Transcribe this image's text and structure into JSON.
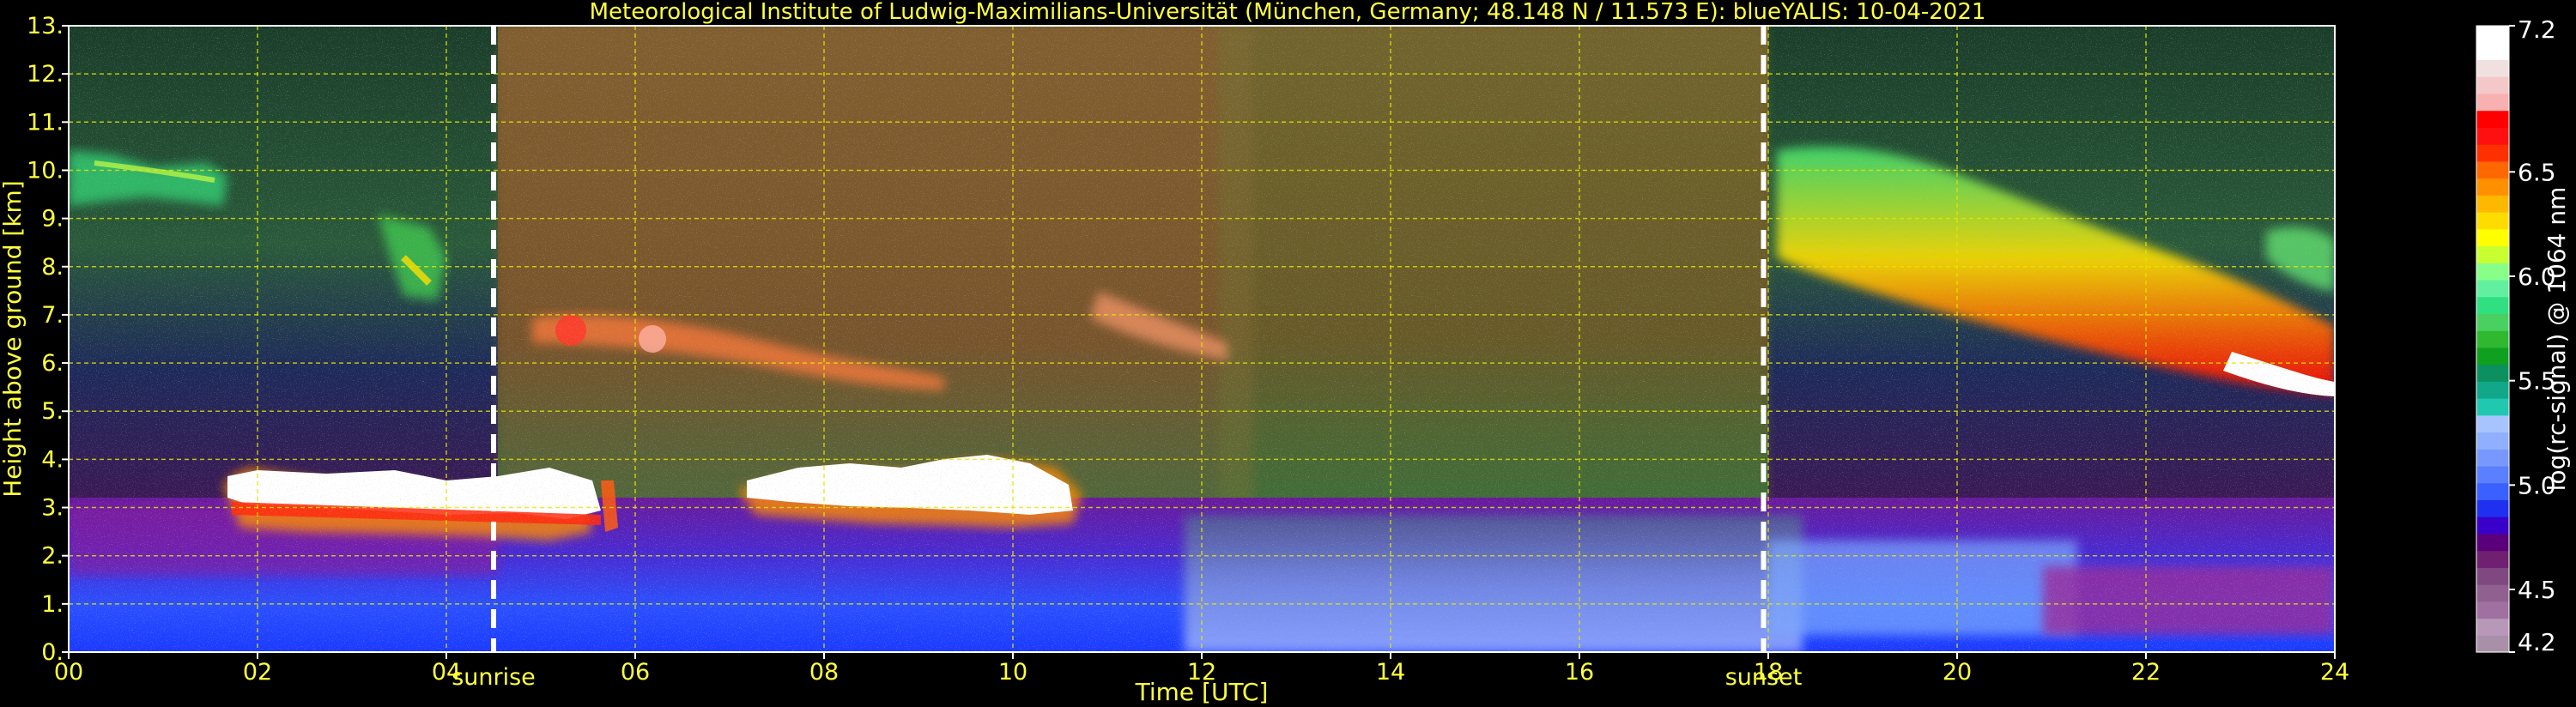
{
  "chart_data": {
    "type": "heatmap",
    "title": "Meteorological Institute of Ludwig-Maximilians-Universität (München, Germany; 48.148 N / 11.573 E):     blueYALIS: 10-04-2021",
    "xlabel": "Time [UTC]",
    "ylabel": "Height above ground [km]",
    "xlim": [
      0,
      24
    ],
    "ylim": [
      0,
      13
    ],
    "x_ticks": [
      "00",
      "02",
      "04",
      "06",
      "08",
      "10",
      "12",
      "14",
      "16",
      "18",
      "20",
      "22",
      "24"
    ],
    "y_ticks": [
      "0.",
      "1.",
      "2.",
      "3.",
      "4.",
      "5.",
      "6.",
      "7.",
      "8.",
      "9.",
      "10.",
      "11.",
      "12.",
      "13."
    ],
    "grid": true,
    "grid_color": "#e6e600",
    "background_color": "#000000",
    "text_color": "#ffff3c",
    "markers": [
      {
        "label": "sunrise",
        "x": 4.5
      },
      {
        "label": "sunset",
        "x": 17.95
      }
    ],
    "colorbar": {
      "label": "log(rc-signal) @ 1064 nm",
      "range": [
        4.2,
        7.2
      ],
      "tick_labels": [
        "7.2",
        "6.5",
        "6.0",
        "5.5",
        "5.0",
        "4.5",
        "4.2"
      ],
      "tick_values": [
        7.2,
        6.5,
        6.0,
        5.5,
        5.0,
        4.5,
        4.2
      ],
      "colors_low_to_high": [
        "#a890a8",
        "#b898b8",
        "#a070a0",
        "#906090",
        "#804880",
        "#702070",
        "#5a007a",
        "#3800c8",
        "#2030f0",
        "#3a60ff",
        "#5a80ff",
        "#7898ff",
        "#90b0ff",
        "#a8c4ff",
        "#20c8b0",
        "#10a888",
        "#0c9060",
        "#10a020",
        "#30b830",
        "#48d060",
        "#30e080",
        "#60f0a0",
        "#88ff88",
        "#c8ff30",
        "#ffff00",
        "#ffdc00",
        "#ffb800",
        "#ff9000",
        "#ff6800",
        "#ff3000",
        "#ff1010",
        "#ff0000",
        "#f8b0b0",
        "#f4c8c8",
        "#f0e0e0",
        "#ffffff",
        "#ffffff"
      ]
    },
    "features": [
      {
        "name": "cirrus patch",
        "x": [
          0.0,
          1.7
        ],
        "y": [
          9.6,
          10.5
        ],
        "signal": 5.6
      },
      {
        "name": "cirrus patch",
        "x": [
          3.4,
          4.0
        ],
        "y": [
          7.1,
          8.6
        ],
        "signal": 5.7
      },
      {
        "name": "low cloud layer",
        "x": [
          1.7,
          5.8
        ],
        "y": [
          2.4,
          3.7
        ],
        "signal": 7.0
      },
      {
        "name": "low cloud layer",
        "x": [
          7.3,
          10.8
        ],
        "y": [
          2.5,
          4.0
        ],
        "signal": 7.0
      },
      {
        "name": "aerosol layer",
        "x": [
          5.0,
          12.2
        ],
        "y": [
          5.7,
          7.1
        ],
        "signal": 6.2
      },
      {
        "name": "cirrus band",
        "x": [
          18.2,
          24.0
        ],
        "y": [
          5.3,
          10.5
        ],
        "signal": 6.4
      },
      {
        "name": "boundary layer",
        "x": [
          0.0,
          24.0
        ],
        "y": [
          0.0,
          2.0
        ],
        "signal": 4.9
      }
    ]
  }
}
